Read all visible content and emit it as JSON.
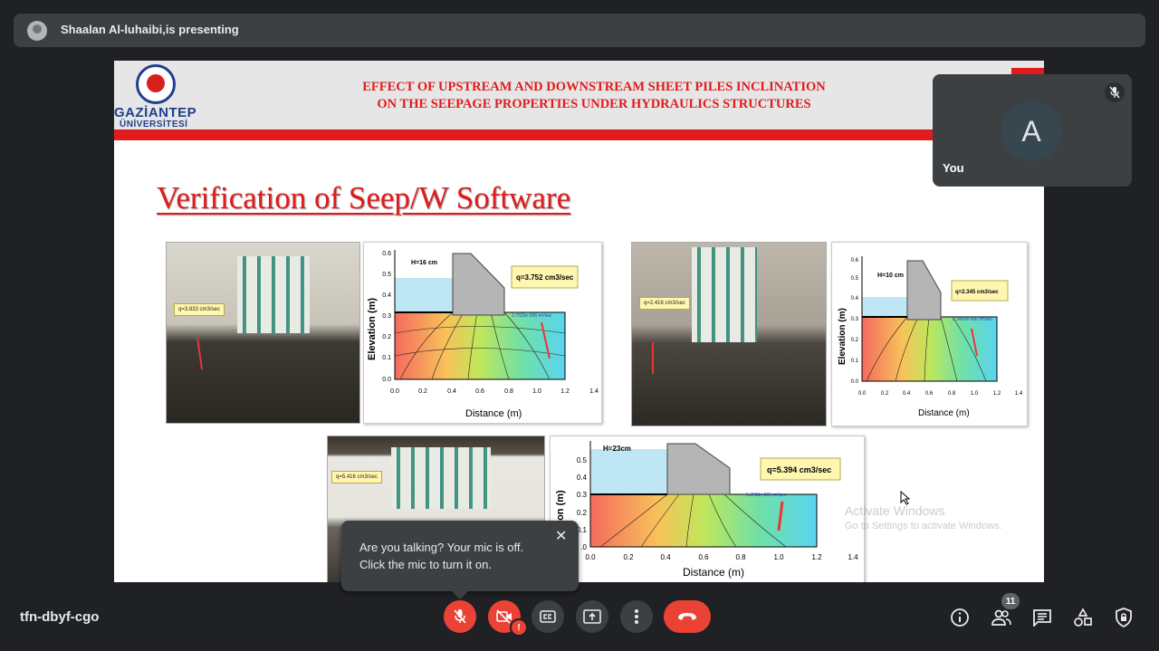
{
  "presenting": {
    "text": "Shaalan Al-luhaibi,is presenting"
  },
  "slide": {
    "logo_line1": "GAZİANTEP",
    "logo_line2": "ÜNİVERSİTESİ",
    "title_line1": "EFFECT OF UPSTREAM AND DOWNSTREAM SHEET PILES INCLINATION",
    "title_line2": "ON THE SEEPAGE PROPERTIES UNDER HYDRAULICS STRUCTURES",
    "heading": "Verification of Seep/W Software",
    "photos": [
      {
        "callout": "q=3.833 cm3/sec"
      },
      {
        "callout": "q=2.416 cm3/sec"
      },
      {
        "callout": "q=5.416 cm3/sec"
      }
    ],
    "charts": [
      {
        "head": "H=16 cm",
        "q": "q=3.752 cm3/sec",
        "flux": "3.7525e-006 m³/sec"
      },
      {
        "head": "H=10 cm",
        "q": "q=2.345 cm3/sec",
        "flux": "2.3450e-006 m³/sec"
      },
      {
        "head": "H=23cm",
        "q": "q=5.394 cm3/sec",
        "flux": "5.3943e-006 m³/sec"
      }
    ],
    "ylabel": "Elevation (m)",
    "ylabel_partial": "evation (m)",
    "xlabel": "Distance (m)",
    "x_ticks": [
      "0.0",
      "0.2",
      "0.4",
      "0.6",
      "0.8",
      "1.0",
      "1.2",
      "1.4"
    ],
    "y_ticks": [
      "0.0",
      "0.1",
      "0.2",
      "0.3",
      "0.4",
      "0.5",
      "0.6"
    ],
    "y_ticks_3": [
      ".0",
      "0.1",
      "0.2",
      "0.3",
      "0.4",
      "0.5"
    ]
  },
  "self_tile": {
    "initial": "A",
    "label": "You"
  },
  "watermark": {
    "line1": "Activate Windows",
    "line2": "Go to Settings to activate Windows."
  },
  "tooltip": {
    "line1": "Are you talking? Your mic is off.",
    "line2": "Click the mic to turn it on.",
    "close": "✕"
  },
  "bottom_bar": {
    "meeting_code": "tfn-dbyf-cgo",
    "people_count": "11",
    "cam_alert": "!"
  },
  "colors": {
    "bg": "#202124",
    "panel": "#3c4043",
    "red": "#ea4335",
    "slide_red": "#e11b1b"
  }
}
